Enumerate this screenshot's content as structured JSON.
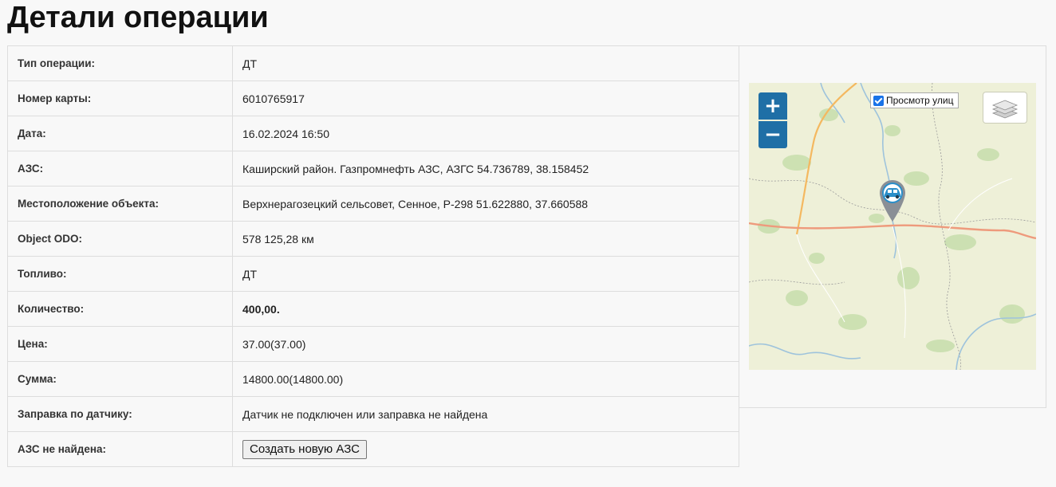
{
  "page": {
    "title": "Детали операции"
  },
  "details": {
    "rows": [
      {
        "label": "Тип операции:",
        "value": "ДТ"
      },
      {
        "label": "Номер карты:",
        "value": "6010765917"
      },
      {
        "label": "Дата:",
        "value": "16.02.2024 16:50"
      },
      {
        "label": "АЗС:",
        "value": "Каширский район. Газпромнефть АЗС, АЗГС 54.736789, 38.158452"
      },
      {
        "label": "Местоположение объекта:",
        "value": "Верхнерагозецкий сельсовет, Сенное, Р-298 51.622880, 37.660588"
      },
      {
        "label": "Object ODO:",
        "value": "578 125,28 км"
      },
      {
        "label": "Топливо:",
        "value": "ДТ"
      },
      {
        "label": "Количество:",
        "value": "400,00."
      },
      {
        "label": "Цена:",
        "value": "37.00(37.00)"
      },
      {
        "label": "Сумма:",
        "value": "14800.00(14800.00)"
      },
      {
        "label": "Заправка по датчику:",
        "value": "Датчик не подключен или заправка не найдена"
      },
      {
        "label": "АЗС не найдена:",
        "button_label": "Создать новую АЗС"
      }
    ]
  },
  "map": {
    "zoom_in_label": "+",
    "zoom_out_label": "−",
    "street_view_label": "Просмотр улиц",
    "street_view_checked": true,
    "marker_icon": "car-icon",
    "layers_icon": "layers-icon",
    "colors": {
      "land": "#eef0d8",
      "forest": "#c9dfae",
      "water": "#9ec3dc",
      "main_road": "#ee9a7c",
      "secondary_road": "#f4b860",
      "border": "#9a9a9a",
      "controls": "#1f6fa6"
    }
  }
}
